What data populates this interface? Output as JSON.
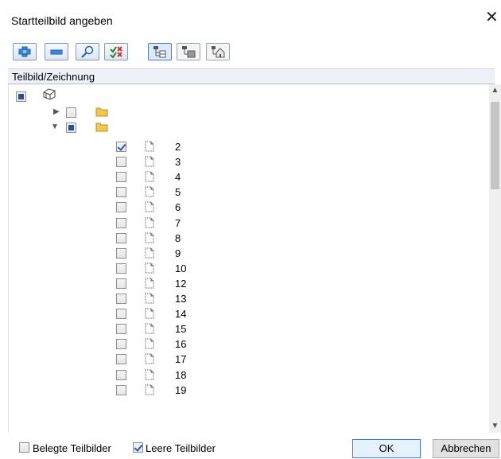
{
  "dialog": {
    "title": "Startteilbild angeben",
    "close_glyph": "✕"
  },
  "toolbar": {
    "buttons": [
      {
        "name": "expand-all-button",
        "icon": "plus-icon"
      },
      {
        "name": "collapse-all-button",
        "icon": "minus-icon"
      },
      {
        "name": "search-button",
        "icon": "magnifier-icon"
      },
      {
        "name": "checklist-button",
        "icon": "check-cross-icon"
      },
      {
        "name": "structure-view-button",
        "icon": "tree-structure-icon"
      },
      {
        "name": "layer-view-button",
        "icon": "layer-structure-icon"
      },
      {
        "name": "building-view-button",
        "icon": "building-structure-icon"
      }
    ]
  },
  "tree": {
    "column_header": "Teilbild/Zeichnung",
    "rows": [
      {
        "label": "2",
        "checked": true
      },
      {
        "label": "3",
        "checked": false
      },
      {
        "label": "4",
        "checked": false
      },
      {
        "label": "5",
        "checked": false
      },
      {
        "label": "6",
        "checked": false
      },
      {
        "label": "7",
        "checked": false
      },
      {
        "label": "8",
        "checked": false
      },
      {
        "label": "9",
        "checked": false
      },
      {
        "label": "10",
        "checked": false
      },
      {
        "label": "12",
        "checked": false
      },
      {
        "label": "13",
        "checked": false
      },
      {
        "label": "14",
        "checked": false
      },
      {
        "label": "15",
        "checked": false
      },
      {
        "label": "16",
        "checked": false
      },
      {
        "label": "17",
        "checked": false
      },
      {
        "label": "18",
        "checked": false
      },
      {
        "label": "19",
        "checked": false
      }
    ]
  },
  "footer": {
    "belegte_label": "Belegte Teilbilder",
    "belegte_checked": false,
    "leere_label": "Leere Teilbilder",
    "leere_checked": true,
    "ok_label": "OK",
    "cancel_label": "Abbrechen"
  },
  "colors": {
    "accent": "#2a4f9b",
    "folder": "#f2c94c"
  }
}
